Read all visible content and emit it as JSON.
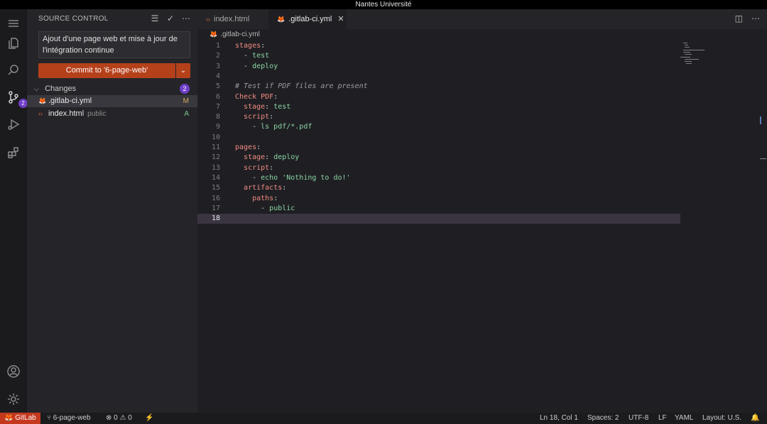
{
  "window": {
    "title": "Nantes Université"
  },
  "activity_bar": {
    "source_control_badge": "2"
  },
  "sidebar": {
    "title": "SOURCE CONTROL",
    "commit_message": "Ajout d'une page web et mise à jour de l'intégration continue",
    "commit_button": "Commit to '6-page-web'",
    "changes_label": "Changes",
    "changes_count": "2",
    "files": [
      {
        "name": ".gitlab-ci.yml",
        "dir": "",
        "status": "M",
        "status_color": "#d7a95c"
      },
      {
        "name": "index.html",
        "dir": "public",
        "status": "A",
        "status_color": "#7cc48a"
      }
    ]
  },
  "tabs": [
    {
      "label": "index.html"
    },
    {
      "label": ".gitlab-ci.yml",
      "close": "✕"
    }
  ],
  "breadcrumb": ".gitlab-ci.yml",
  "code_lines": [
    {
      "n": "1",
      "parts": [
        [
          "k",
          "stages"
        ],
        [
          "p",
          ":"
        ]
      ]
    },
    {
      "n": "2",
      "parts": [
        [
          "p",
          "  - "
        ],
        [
          "v",
          "test"
        ]
      ]
    },
    {
      "n": "3",
      "parts": [
        [
          "p",
          "  - "
        ],
        [
          "v",
          "deploy"
        ]
      ]
    },
    {
      "n": "4",
      "parts": []
    },
    {
      "n": "5",
      "parts": [
        [
          "c",
          "# Test if PDF files are present"
        ]
      ]
    },
    {
      "n": "6",
      "parts": [
        [
          "k",
          "Check PDF"
        ],
        [
          "p",
          ":"
        ]
      ]
    },
    {
      "n": "7",
      "parts": [
        [
          "p",
          "  "
        ],
        [
          "k",
          "stage"
        ],
        [
          "p",
          ": "
        ],
        [
          "v",
          "test"
        ]
      ]
    },
    {
      "n": "8",
      "parts": [
        [
          "p",
          "  "
        ],
        [
          "k",
          "script"
        ],
        [
          "p",
          ":"
        ]
      ]
    },
    {
      "n": "9",
      "parts": [
        [
          "p",
          "    - "
        ],
        [
          "v",
          "ls pdf/*.pdf"
        ]
      ]
    },
    {
      "n": "10",
      "parts": []
    },
    {
      "n": "11",
      "parts": [
        [
          "k",
          "pages"
        ],
        [
          "p",
          ":"
        ]
      ]
    },
    {
      "n": "12",
      "parts": [
        [
          "p",
          "  "
        ],
        [
          "k",
          "stage"
        ],
        [
          "p",
          ": "
        ],
        [
          "v",
          "deploy"
        ]
      ]
    },
    {
      "n": "13",
      "parts": [
        [
          "p",
          "  "
        ],
        [
          "k",
          "script"
        ],
        [
          "p",
          ":"
        ]
      ]
    },
    {
      "n": "14",
      "parts": [
        [
          "p",
          "    - "
        ],
        [
          "v",
          "echo 'Nothing to do!'"
        ]
      ]
    },
    {
      "n": "15",
      "parts": [
        [
          "p",
          "  "
        ],
        [
          "k",
          "artifacts"
        ],
        [
          "p",
          ":"
        ]
      ]
    },
    {
      "n": "16",
      "parts": [
        [
          "p",
          "    "
        ],
        [
          "k",
          "paths"
        ],
        [
          "p",
          ":"
        ]
      ]
    },
    {
      "n": "17",
      "parts": [
        [
          "p",
          "      - "
        ],
        [
          "v",
          "public"
        ]
      ]
    },
    {
      "n": "18",
      "parts": []
    }
  ],
  "current_line": "18",
  "status_bar": {
    "remote": "GitLab",
    "branch": "6-page-web",
    "errors": "0",
    "warnings": "0",
    "cursor": "Ln 18, Col 1",
    "spaces": "Spaces: 2",
    "encoding": "UTF-8",
    "eol": "LF",
    "language": "YAML",
    "layout": "Layout: U.S."
  }
}
